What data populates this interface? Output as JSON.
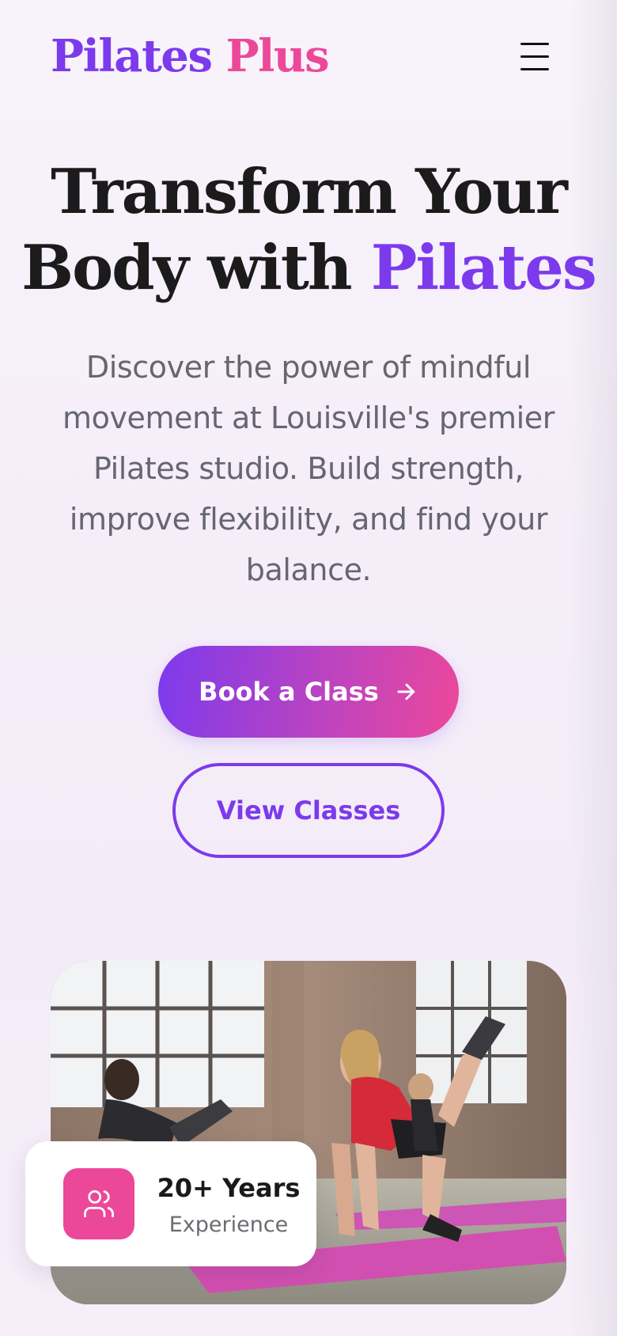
{
  "brand": {
    "name_part1": "Pilates",
    "name_part2": "Plus"
  },
  "nav": {
    "menu_icon": "hamburger-menu-icon"
  },
  "hero": {
    "title_line1": "Transform Your",
    "title_line2_prefix": "Body with ",
    "title_line2_accent": "Pilates",
    "description": "Discover the power of mindful movement at Louisville's premier Pilates studio. Build strength, improve flexibility, and find your balance.",
    "primary_cta": "Book a Class",
    "primary_cta_icon": "arrow-right-icon",
    "secondary_cta": "View Classes"
  },
  "stat_card": {
    "icon": "users-icon",
    "title": "20+ Years",
    "subtitle": "Experience"
  },
  "image": {
    "subject": "pilates-class-photo"
  },
  "colors": {
    "purple": "#7c3aed",
    "pink": "#ec4899",
    "heading": "#1b1b1b",
    "body_text": "#666670"
  }
}
